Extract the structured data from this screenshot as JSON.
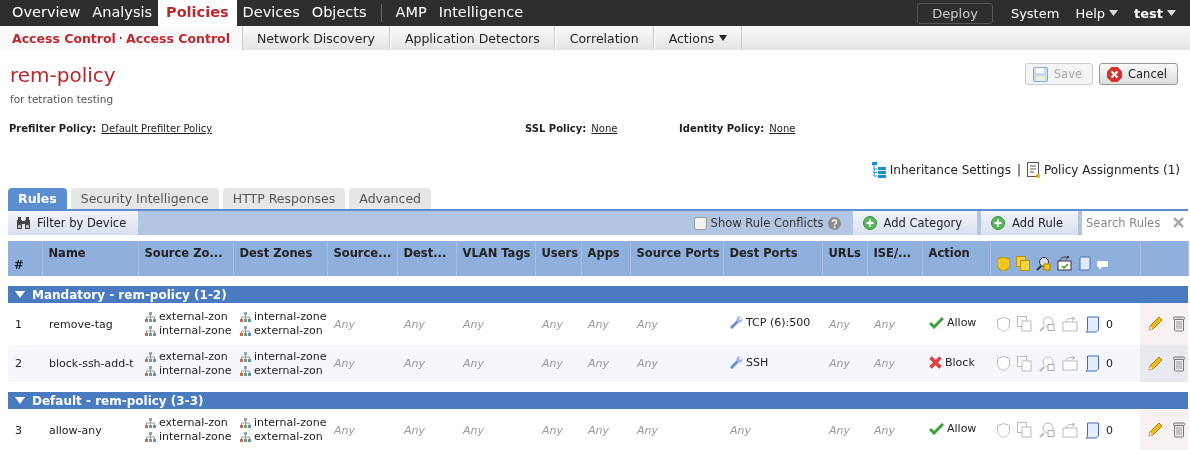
{
  "top_nav": {
    "primary": [
      {
        "label": "Overview",
        "selected": false
      },
      {
        "label": "Analysis",
        "selected": false
      },
      {
        "label": "Policies",
        "selected": true
      },
      {
        "label": "Devices",
        "selected": false
      },
      {
        "label": "Objects",
        "selected": false
      }
    ],
    "secondary": [
      {
        "label": "AMP",
        "selected": false
      },
      {
        "label": "Intelligence",
        "selected": false
      }
    ],
    "deploy": "Deploy",
    "system": "System",
    "help": "Help",
    "user": "test"
  },
  "sub_nav": {
    "breadcrumb": [
      "Access Control",
      "Access Control"
    ],
    "items": [
      "Network Discovery",
      "Application Detectors",
      "Correlation"
    ],
    "actions": "Actions"
  },
  "policy": {
    "name": "rem-policy",
    "description": "for tetration testing",
    "save": {
      "label": "Save",
      "disabled": true
    },
    "cancel": "Cancel"
  },
  "settings": [
    {
      "label": "Prefilter Policy:",
      "value": "Default Prefilter Policy"
    },
    {
      "label": "SSL Policy:",
      "value": "None"
    },
    {
      "label": "Identity Policy:",
      "value": "None"
    }
  ],
  "links": {
    "inheritance": "Inheritance Settings",
    "separator": "|",
    "assignments": "Policy Assignments (1)"
  },
  "tabs": [
    {
      "label": "Rules",
      "selected": true
    },
    {
      "label": "Security Intelligence",
      "selected": false
    },
    {
      "label": "HTTP Responses",
      "selected": false
    },
    {
      "label": "Advanced",
      "selected": false
    }
  ],
  "toolbar": {
    "filter": "Filter by Device",
    "show_conflicts": {
      "label": "Show Rule Conflicts",
      "checked": false
    },
    "add_category": "Add Category",
    "add_rule": "Add Rule",
    "search": {
      "placeholder": "Search Rules"
    }
  },
  "table": {
    "columns": [
      "#",
      "Name",
      "Source Zo...",
      "Dest Zones",
      "Source...",
      "Dest...",
      "VLAN Tags",
      "Users",
      "Apps",
      "Source Ports",
      "Dest Ports",
      "URLs",
      "ISE/...",
      "Action"
    ],
    "groups": [
      {
        "title": "Mandatory - rem-policy (1-2)",
        "expanded": true,
        "rows": [
          {
            "number": "1",
            "name": "remove-tag",
            "source_zones": [
              "external-zon",
              "internal-zone"
            ],
            "dest_zones": [
              "internal-zone",
              "external-zon"
            ],
            "source_networks": "Any",
            "dest_networks": "Any",
            "vlan_tags": "Any",
            "users": "Any",
            "apps": "Any",
            "source_ports": "Any",
            "dest_ports": {
              "kind": "port",
              "text": "TCP (6):500"
            },
            "urls": "Any",
            "ise": "Any",
            "action": {
              "kind": "allow",
              "label": "Allow"
            },
            "count": "0"
          },
          {
            "number": "2",
            "name": "block-ssh-add-t",
            "source_zones": [
              "external-zon",
              "internal-zone"
            ],
            "dest_zones": [
              "internal-zone",
              "external-zon"
            ],
            "source_networks": "Any",
            "dest_networks": "Any",
            "vlan_tags": "Any",
            "users": "Any",
            "apps": "Any",
            "source_ports": "Any",
            "dest_ports": {
              "kind": "port",
              "text": "SSH"
            },
            "urls": "Any",
            "ise": "Any",
            "action": {
              "kind": "block",
              "label": "Block"
            },
            "count": "0"
          }
        ]
      },
      {
        "title": "Default - rem-policy (3-3)",
        "expanded": true,
        "rows": [
          {
            "number": "3",
            "name": "allow-any",
            "source_zones": [
              "external-zon",
              "internal-zone"
            ],
            "dest_zones": [
              "internal-zone",
              "external-zon"
            ],
            "source_networks": "Any",
            "dest_networks": "Any",
            "vlan_tags": "Any",
            "users": "Any",
            "apps": "Any",
            "source_ports": "Any",
            "dest_ports": {
              "kind": "any",
              "text": "Any"
            },
            "urls": "Any",
            "ise": "Any",
            "action": {
              "kind": "allow",
              "label": "Allow"
            },
            "count": "0"
          }
        ]
      }
    ]
  }
}
